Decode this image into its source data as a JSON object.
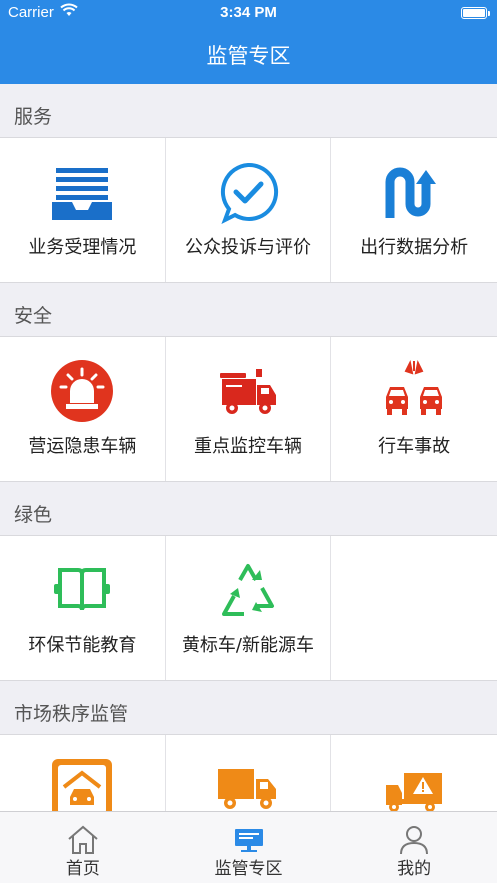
{
  "status_bar": {
    "carrier": "Carrier",
    "time": "3:34 PM"
  },
  "navbar": {
    "title": "监管专区"
  },
  "sections": [
    {
      "title": "服务",
      "items": [
        {
          "label": "业务受理情况",
          "icon": "inbox-tray-icon"
        },
        {
          "label": "公众投诉与评价",
          "icon": "check-bubble-icon"
        },
        {
          "label": "出行数据分析",
          "icon": "route-arrow-icon"
        }
      ]
    },
    {
      "title": "安全",
      "items": [
        {
          "label": "营运隐患车辆",
          "icon": "alarm-siren-icon"
        },
        {
          "label": "重点监控车辆",
          "icon": "truck-siren-icon"
        },
        {
          "label": "行车事故",
          "icon": "car-collision-icon"
        }
      ]
    },
    {
      "title": "绿色",
      "items": [
        {
          "label": "环保节能教育",
          "icon": "open-book-icon"
        },
        {
          "label": "黄标车/新能源车",
          "icon": "recycle-icon"
        }
      ]
    },
    {
      "title": "市场秩序监管",
      "items": [
        {
          "label": "",
          "icon": "garage-car-icon"
        },
        {
          "label": "",
          "icon": "delivery-truck-icon"
        },
        {
          "label": "",
          "icon": "warning-truck-icon"
        }
      ]
    }
  ],
  "tabbar": [
    {
      "label": "首页",
      "icon": "home-icon",
      "active": false
    },
    {
      "label": "监管专区",
      "icon": "monitor-icon",
      "active": true
    },
    {
      "label": "我的",
      "icon": "user-icon",
      "active": false
    }
  ],
  "colors": {
    "primary": "#2b8ae6",
    "danger": "#e0341e",
    "green": "#2ebd59",
    "orange": "#ef8a17"
  }
}
